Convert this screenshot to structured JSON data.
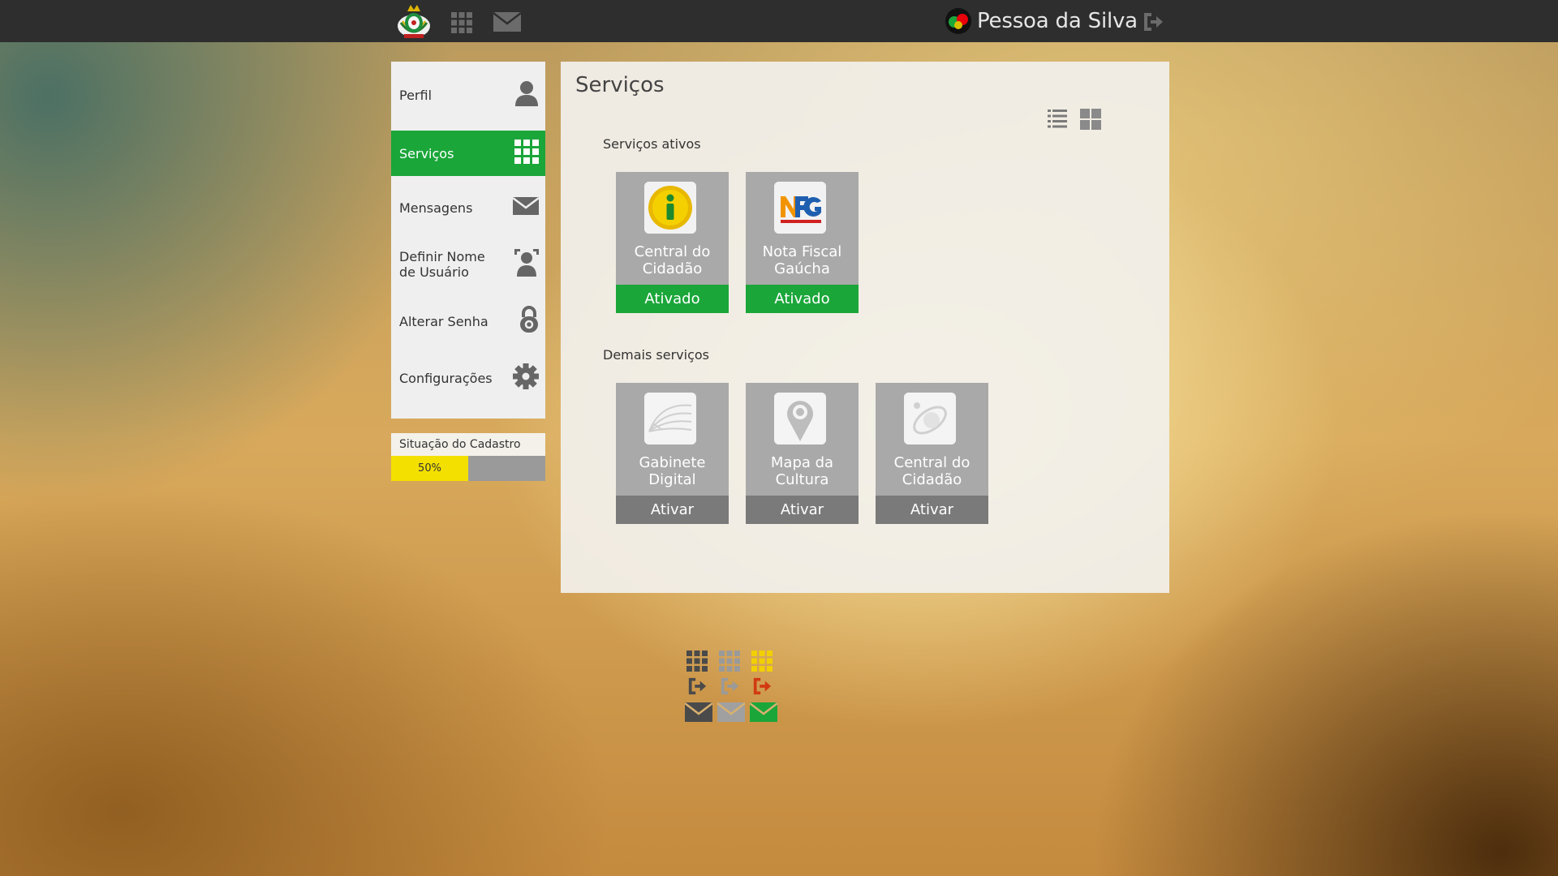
{
  "topbar": {
    "logo_icon": "rs-coat-of-arms-icon",
    "apps_icon": "grid-icon",
    "messages_icon": "envelope-icon",
    "user_name": "Pessoa da Silva",
    "logout_icon": "logout-icon"
  },
  "sidebar": {
    "items": [
      {
        "label": "Perfil",
        "icon": "user-icon"
      },
      {
        "label": "Serviços",
        "icon": "grid-icon",
        "active": true
      },
      {
        "label": "Mensagens",
        "icon": "envelope-icon"
      },
      {
        "label": "Definir Nome de Usuário",
        "icon": "user-id-icon"
      },
      {
        "label": "Alterar Senha",
        "icon": "lock-icon"
      },
      {
        "label": "Configurações",
        "icon": "gear-icon"
      }
    ],
    "active_color": "#1ba63a"
  },
  "registration": {
    "title": "Situação do Cadastro",
    "percent_label": "50%",
    "percent": 50,
    "fill_color": "#f4e000"
  },
  "main": {
    "title": "Serviços",
    "view_icons": [
      "list-view-icon",
      "grid-view-icon"
    ],
    "active_section": {
      "label": "Serviços ativos",
      "services": [
        {
          "name": "Central do Cidadão",
          "action": "Ativado",
          "icon": "info-icon"
        },
        {
          "name": "Nota Fiscal Gaúcha",
          "action": "Ativado",
          "icon": "nfg-logo-icon"
        }
      ]
    },
    "other_section": {
      "label": "Demais serviços",
      "services": [
        {
          "name": "Gabinete Digital",
          "action": "Ativar",
          "icon": "gabinete-logo-icon"
        },
        {
          "name": "Mapa da Cultura",
          "action": "Ativar",
          "icon": "map-pin-icon"
        },
        {
          "name": "Central do Cidadão",
          "action": "Ativar",
          "icon": "orbit-logo-icon"
        }
      ]
    }
  },
  "colors": {
    "topbar": "#2e2e2e",
    "green": "#1ba63a",
    "yellow": "#f4e000",
    "card_gray": "#a9a9a9",
    "button_gray": "#7a7a7a"
  }
}
